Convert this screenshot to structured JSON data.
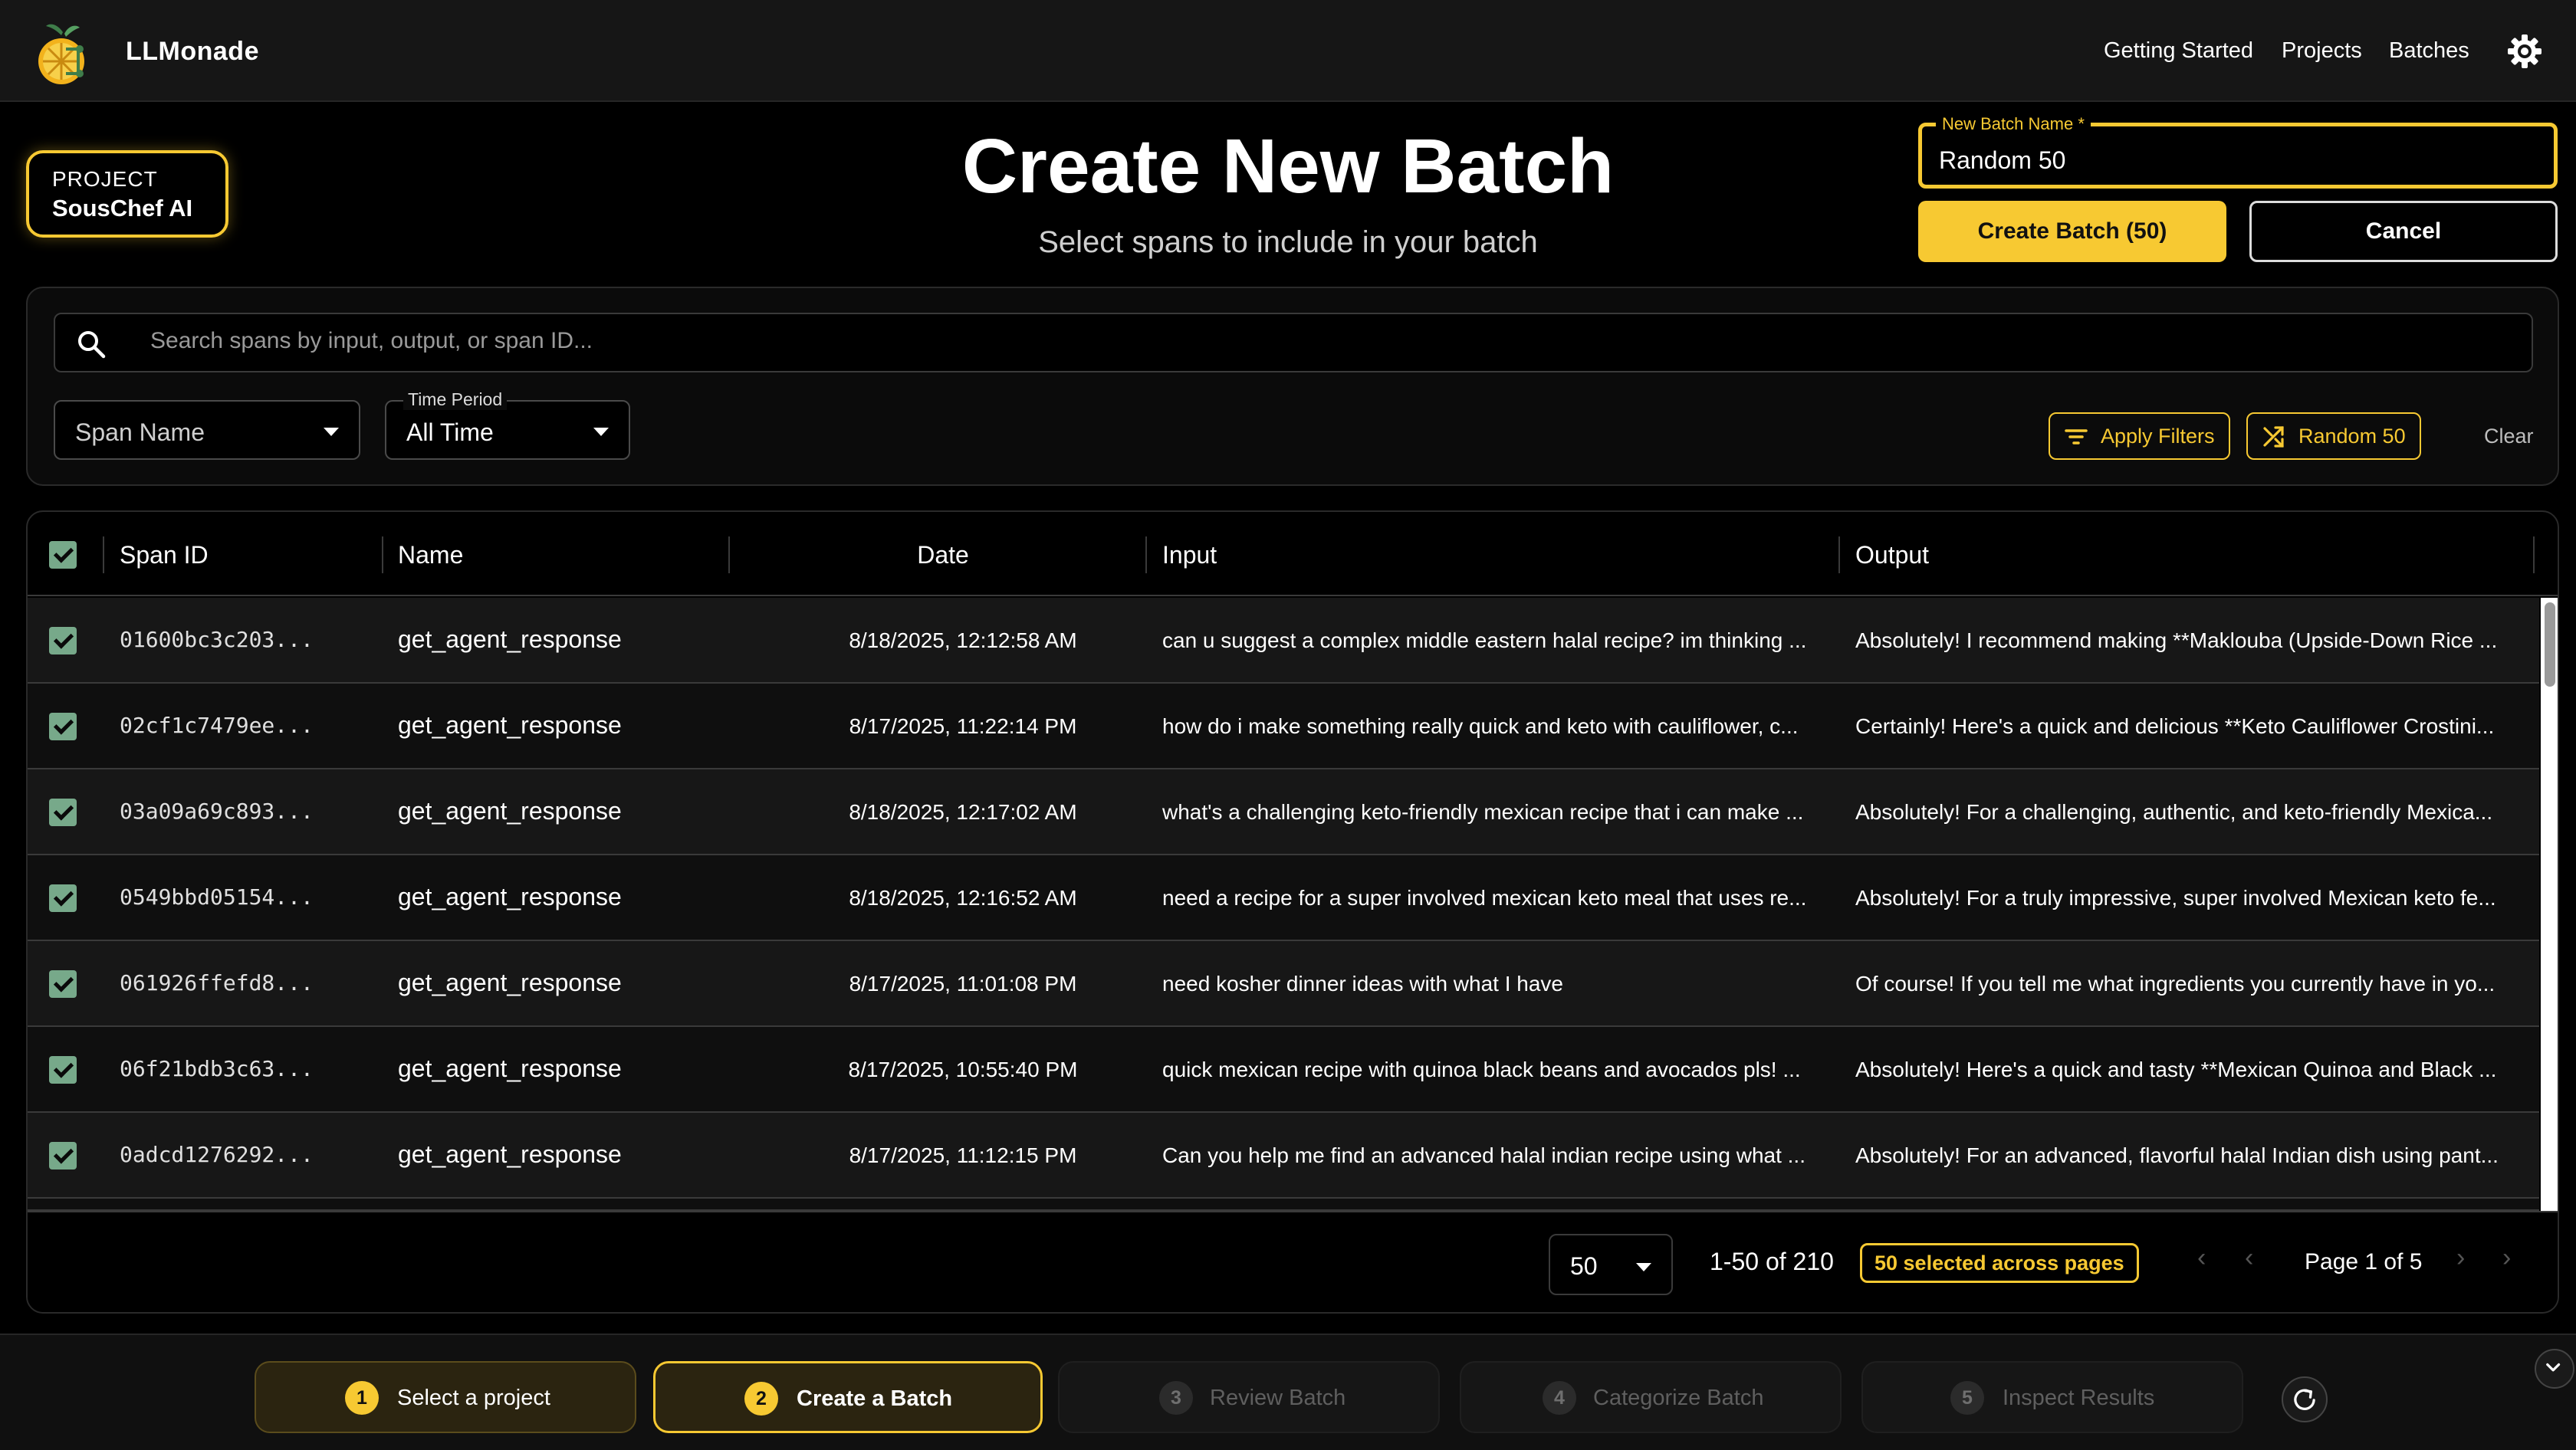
{
  "app": {
    "name": "LLMonade"
  },
  "nav": {
    "links": [
      {
        "label": "Getting Started"
      },
      {
        "label": "Projects"
      },
      {
        "label": "Batches"
      }
    ]
  },
  "project": {
    "label": "PROJECT",
    "name": "SousChef AI"
  },
  "header": {
    "title": "Create New Batch",
    "subtitle": "Select spans to include in your batch"
  },
  "batch_form": {
    "field_label": "New Batch Name",
    "required_mark": "*",
    "value": "Random 50",
    "create_label": "Create Batch (50)",
    "cancel_label": "Cancel"
  },
  "filters": {
    "search_placeholder": "Search spans by input, output, or span ID...",
    "span_name_value": "Span Name",
    "time_period_label": "Time Period",
    "time_period_value": "All Time",
    "apply_label": "Apply Filters",
    "random_label": "Random 50",
    "clear_label": "Clear"
  },
  "table": {
    "columns": [
      "Span ID",
      "Name",
      "Date",
      "Input",
      "Output"
    ],
    "rows": [
      {
        "id": "01600bc3c203...",
        "name": "get_agent_response",
        "date": "8/18/2025, 12:12:58 AM",
        "input": "can u suggest a complex middle eastern halal recipe? im thinking ...",
        "output": "Absolutely! I recommend making **Maklouba (Upside-Down Rice ..."
      },
      {
        "id": "02cf1c7479ee...",
        "name": "get_agent_response",
        "date": "8/17/2025, 11:22:14 PM",
        "input": "how do i make something really quick and keto with cauliflower, c...",
        "output": "Certainly! Here's a quick and delicious **Keto Cauliflower Crostini..."
      },
      {
        "id": "03a09a69c893...",
        "name": "get_agent_response",
        "date": "8/18/2025, 12:17:02 AM",
        "input": "what's a challenging keto-friendly mexican recipe that i can make ...",
        "output": "Absolutely! For a challenging, authentic, and keto-friendly Mexica..."
      },
      {
        "id": "0549bbd05154...",
        "name": "get_agent_response",
        "date": "8/18/2025, 12:16:52 AM",
        "input": "need a recipe for a super involved mexican keto meal that uses re...",
        "output": "Absolutely! For a truly impressive, super involved Mexican keto fe..."
      },
      {
        "id": "061926ffefd8...",
        "name": "get_agent_response",
        "date": "8/17/2025, 11:01:08 PM",
        "input": "need kosher dinner ideas with what I have",
        "output": "Of course! If you tell me what ingredients you currently have in yo..."
      },
      {
        "id": "06f21bdb3c63...",
        "name": "get_agent_response",
        "date": "8/17/2025, 10:55:40 PM",
        "input": "quick mexican recipe with quinoa black beans and avocados pls! ...",
        "output": "Absolutely! Here's a quick and tasty **Mexican Quinoa and Black ..."
      },
      {
        "id": "0adcd1276292...",
        "name": "get_agent_response",
        "date": "8/17/2025, 11:12:15 PM",
        "input": "Can you help me find an advanced halal indian recipe using what ...",
        "output": "Absolutely! For an advanced, flavorful halal Indian dish using pant..."
      }
    ]
  },
  "pagination": {
    "per_page": "50",
    "range": "1-50 of 210",
    "selected_badge": "50 selected across pages",
    "page_label": "Page 1 of 5"
  },
  "steps": [
    {
      "num": "1",
      "label": "Select a project",
      "state": "done"
    },
    {
      "num": "2",
      "label": "Create a Batch",
      "state": "active"
    },
    {
      "num": "3",
      "label": "Review Batch",
      "state": "todo"
    },
    {
      "num": "4",
      "label": "Categorize Batch",
      "state": "todo"
    },
    {
      "num": "5",
      "label": "Inspect Results",
      "state": "todo"
    }
  ],
  "colors": {
    "accent": "#f7c932",
    "checkbox": "#77a98a",
    "background": "#000000"
  },
  "icons": [
    "lemon-logo-icon",
    "settings-gear-icon",
    "search-icon",
    "filter-icon",
    "shuffle-icon",
    "refresh-icon",
    "chevron-down-icon"
  ]
}
